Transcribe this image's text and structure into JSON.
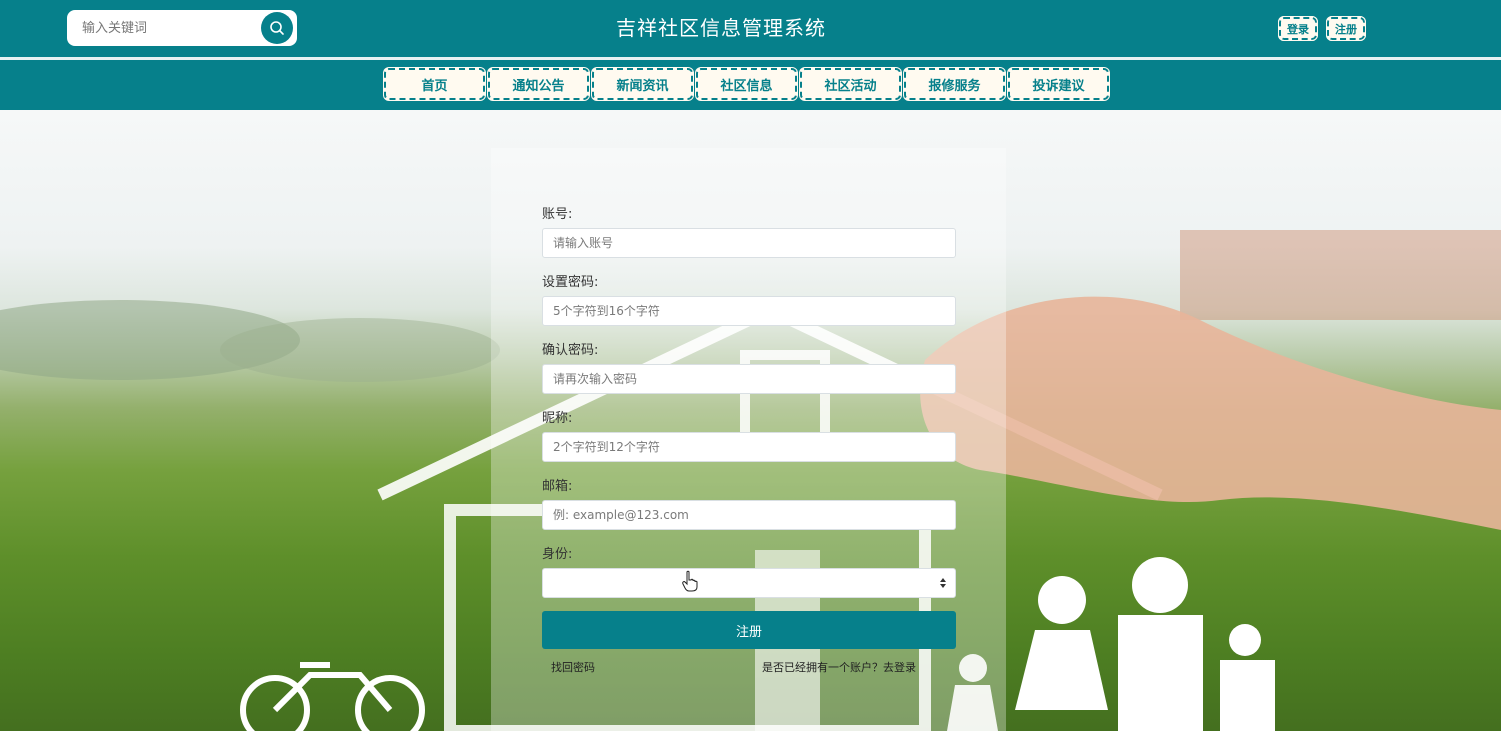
{
  "header": {
    "search_placeholder": "输入关键词",
    "title": "吉祥社区信息管理系统",
    "login_label": "登录",
    "register_label": "注册"
  },
  "nav": {
    "items": [
      {
        "label": "首页"
      },
      {
        "label": "通知公告"
      },
      {
        "label": "新闻资讯"
      },
      {
        "label": "社区信息"
      },
      {
        "label": "社区活动"
      },
      {
        "label": "报修服务"
      },
      {
        "label": "投诉建议"
      }
    ]
  },
  "form": {
    "account_label": "账号:",
    "account_placeholder": "请输入账号",
    "password_label": "设置密码:",
    "password_placeholder": "5个字符到16个字符",
    "confirm_label": "确认密码:",
    "confirm_placeholder": "请再次输入密码",
    "nickname_label": "昵称:",
    "nickname_placeholder": "2个字符到12个字符",
    "email_label": "邮箱:",
    "email_placeholder": "例: example@123.com",
    "role_label": "身份:",
    "role_value": "",
    "submit_label": "注册",
    "forgot_label": "找回密码",
    "have_account_label": "是否已经拥有一个账户？去登录"
  },
  "colors": {
    "brand": "#06808b",
    "button_bg": "#fffaf0"
  },
  "icons": {
    "search": "search-icon",
    "select": "select-caret-icon",
    "cursor": "hand-cursor-icon"
  }
}
